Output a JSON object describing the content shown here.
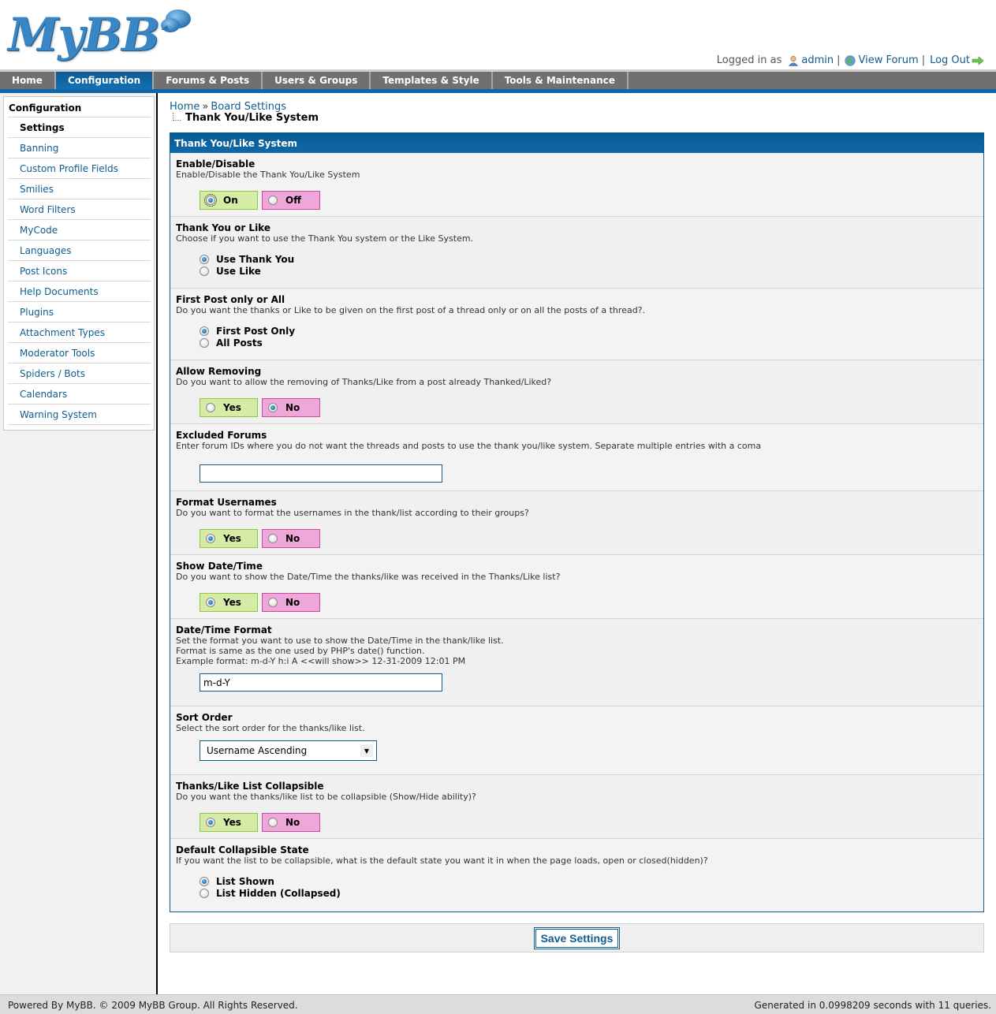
{
  "brand": {
    "logo_text": "MyBB"
  },
  "user_bar": {
    "logged_in_label": "Logged in as",
    "username": "admin",
    "view_forum": "View Forum",
    "logout": "Log Out",
    "separator": "|"
  },
  "menu": {
    "tabs": [
      {
        "label": "Home",
        "active": false
      },
      {
        "label": "Configuration",
        "active": true
      },
      {
        "label": "Forums & Posts",
        "active": false
      },
      {
        "label": "Users & Groups",
        "active": false
      },
      {
        "label": "Templates & Style",
        "active": false
      },
      {
        "label": "Tools & Maintenance",
        "active": false
      }
    ]
  },
  "sidebar": {
    "title": "Configuration",
    "items": [
      {
        "label": "Settings",
        "active": true
      },
      {
        "label": "Banning"
      },
      {
        "label": "Custom Profile Fields"
      },
      {
        "label": "Smilies"
      },
      {
        "label": "Word Filters"
      },
      {
        "label": "MyCode"
      },
      {
        "label": "Languages"
      },
      {
        "label": "Post Icons"
      },
      {
        "label": "Help Documents"
      },
      {
        "label": "Plugins"
      },
      {
        "label": "Attachment Types"
      },
      {
        "label": "Moderator Tools"
      },
      {
        "label": "Spiders / Bots"
      },
      {
        "label": "Calendars"
      },
      {
        "label": "Warning System"
      }
    ]
  },
  "breadcrumb": {
    "home": "Home",
    "separator": "»",
    "board_settings": "Board Settings",
    "current": "Thank You/Like System"
  },
  "panel": {
    "title": "Thank You/Like System",
    "settings": [
      {
        "label": "Enable/Disable",
        "desc": [
          "Enable/Disable the Thank You/Like System"
        ],
        "type": "yesno",
        "options": [
          "On",
          "Off"
        ],
        "selected": 0,
        "focused": true
      },
      {
        "label": "Thank You or Like",
        "desc": [
          "Choose if you want to use the Thank You system or the Like System."
        ],
        "type": "radiolist",
        "options": [
          "Use Thank You",
          "Use Like"
        ],
        "selected": 0
      },
      {
        "label": "First Post only or All",
        "desc": [
          "Do you want the thanks or Like to be given on the first post of a thread only or on all the posts of a thread?."
        ],
        "type": "radiolist",
        "options": [
          "First Post Only",
          "All Posts"
        ],
        "selected": 0
      },
      {
        "label": "Allow Removing",
        "desc": [
          "Do you want to allow the removing of Thanks/Like from a post already Thanked/Liked?"
        ],
        "type": "yesno",
        "options": [
          "Yes",
          "No"
        ],
        "selected": 1
      },
      {
        "label": "Excluded Forums",
        "desc": [
          "Enter forum IDs where you do not want the threads and posts to use the thank you/like system. Separate multiple entries with a coma"
        ],
        "type": "text",
        "value": ""
      },
      {
        "label": "Format Usernames",
        "desc": [
          "Do you want to format the usernames in the thank/list according to their groups?"
        ],
        "type": "yesno",
        "options": [
          "Yes",
          "No"
        ],
        "selected": 0
      },
      {
        "label": "Show Date/Time",
        "desc": [
          "Do you want to show the Date/Time the thanks/like was received in the Thanks/Like list?"
        ],
        "type": "yesno",
        "options": [
          "Yes",
          "No"
        ],
        "selected": 0
      },
      {
        "label": "Date/Time Format",
        "desc": [
          "Set the format you want to use to show the Date/Time in the thank/like list.",
          "Format is same as the one used by PHP's date() function.",
          "Example format: m-d-Y h:i A <<will show>> 12-31-2009 12:01 PM"
        ],
        "type": "text",
        "value": "m-d-Y"
      },
      {
        "label": "Sort Order",
        "desc": [
          "Select the sort order for the thanks/like list."
        ],
        "type": "select",
        "value": "Username Ascending"
      },
      {
        "label": "Thanks/Like List Collapsible",
        "desc": [
          "Do you want the thanks/like list to be collapsible (Show/Hide ability)?"
        ],
        "type": "yesno",
        "options": [
          "Yes",
          "No"
        ],
        "selected": 0
      },
      {
        "label": "Default Collapsible State",
        "desc": [
          "If you want the list to be collapsible, what is the default state you want it in when the page loads, open or closed(hidden)?"
        ],
        "type": "radiolist",
        "options": [
          "List Shown",
          "List Hidden (Collapsed)"
        ],
        "selected": 0
      }
    ]
  },
  "save_label": "Save Settings",
  "footer": {
    "left": "Powered By MyBB. © 2009 MyBB Group. All Rights Reserved.",
    "right": "Generated in 0.0998209 seconds with 11 queries."
  },
  "colors": {
    "accent": "#0f5c8e",
    "menu_bg": "#707070",
    "yes_bg": "#d6eca6",
    "no_bg": "#efa6d8"
  }
}
